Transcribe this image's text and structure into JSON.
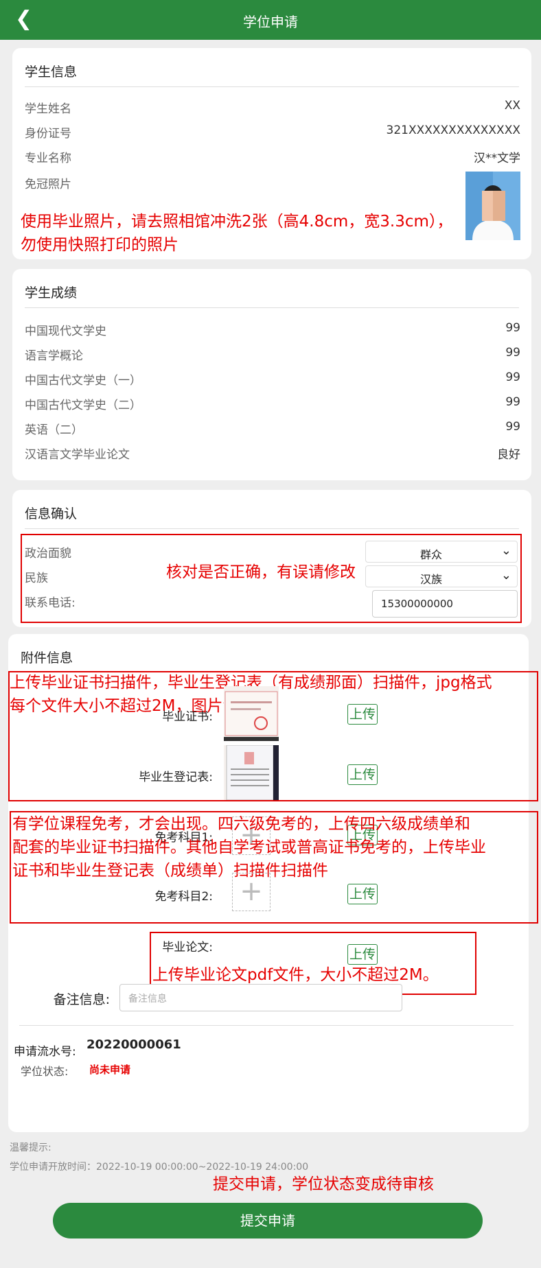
{
  "header": {
    "title": "学位申请",
    "back_icon": "chevron-left-icon"
  },
  "student_info": {
    "title": "学生信息",
    "rows": [
      {
        "label": "学生姓名",
        "value": "XX"
      },
      {
        "label": "身份证号",
        "value": "321XXXXXXXXXXXXXX"
      },
      {
        "label": "专业名称",
        "value": "汉**文学"
      }
    ],
    "photo_label": "免冠照片",
    "annotation": [
      "使用毕业照片，请去照相馆冲洗2张（高4.8cm，宽3.3cm），",
      "勿使用快照打印的照片"
    ]
  },
  "grades": {
    "title": "学生成绩",
    "rows": [
      {
        "label": "中国现代文学史",
        "value": "99"
      },
      {
        "label": "语言学概论",
        "value": "99"
      },
      {
        "label": "中国古代文学史（一）",
        "value": "99"
      },
      {
        "label": "中国古代文学史（二）",
        "value": "99"
      },
      {
        "label": "英语（二）",
        "value": "99"
      },
      {
        "label": "汉语言文学毕业论文",
        "value": "良好"
      }
    ]
  },
  "confirm": {
    "title": "信息确认",
    "political_label": "政治面貌",
    "political_value": "群众",
    "ethnic_label": "民族",
    "ethnic_value": "汉族",
    "phone_label": "联系电话:",
    "phone_value": "15300000000",
    "annotation": "核对是否正确，有误请修改"
  },
  "attachments": {
    "title": "附件信息",
    "annotation1": [
      "上传毕业证书扫描件，毕业生登记表（有成绩那面）扫描件，jpg格式",
      "每个文件大小不超过2M，图片清晰"
    ],
    "diploma_label": "毕业证书:",
    "register_label": "毕业生登记表:",
    "annotation2": [
      "有学位课程免考，才会出现。四六级免考的，上传四六级成绩单和",
      "配套的毕业证书扫描件。其他自学考试或普高证书免考的，上传毕业",
      "证书和毕业生登记表（成绩单）扫描件扫描件"
    ],
    "exempt1_label": "免考科目1:",
    "exempt2_label": "免考科目2:",
    "thesis_label": "毕业论文:",
    "annotation3": "上传毕业论文pdf文件，大小不超过2M。",
    "upload_label": "上传",
    "add_symbol": "+",
    "remark_label": "备注信息:",
    "remark_placeholder": "备注信息",
    "serial_label": "申请流水号:",
    "serial_value": "20220000061",
    "status_label": "学位状态:",
    "status_value": "尚未申请"
  },
  "footer": {
    "tip_title": "温馨提示:",
    "tip_time": "学位申请开放时间：2022-10-19 00:00:00~2022-10-19 24:00:00",
    "annotation": "提交申请，学位状态变成待审核",
    "submit_label": "提交申请"
  },
  "colors": {
    "primary": "#2b8a3e",
    "annotation": "#e60000",
    "status": "#e60000"
  }
}
